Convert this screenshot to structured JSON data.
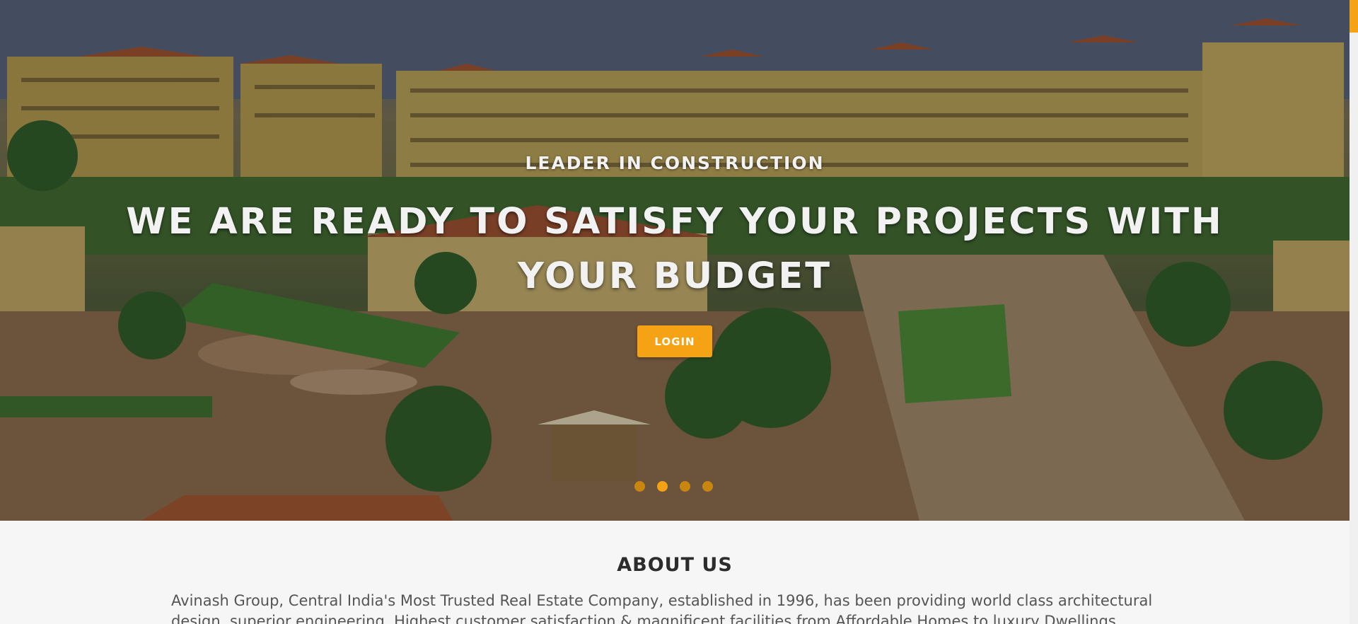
{
  "hero": {
    "eyebrow": "LEADER IN CONSTRUCTION",
    "headline_line1": "WE ARE READY TO SATISFY YOUR PROJECTS WITH",
    "headline_line2": "YOUR BUDGET",
    "login_label": "LOGIN",
    "slides": [
      {
        "active": false
      },
      {
        "active": true
      },
      {
        "active": false
      },
      {
        "active": false
      }
    ]
  },
  "about": {
    "title": "ABOUT US",
    "text": "Avinash Group, Central India's Most Trusted Real Estate Company, established in 1996, has been providing world class architectural design, superior engineering, Highest customer satisfaction & magnificent facilities from Affordable Homes to luxury Dwellings, developing integrated"
  },
  "colors": {
    "accent": "#f5a214",
    "accent_dim": "#c8860f",
    "about_bg": "#f7f6f6"
  }
}
